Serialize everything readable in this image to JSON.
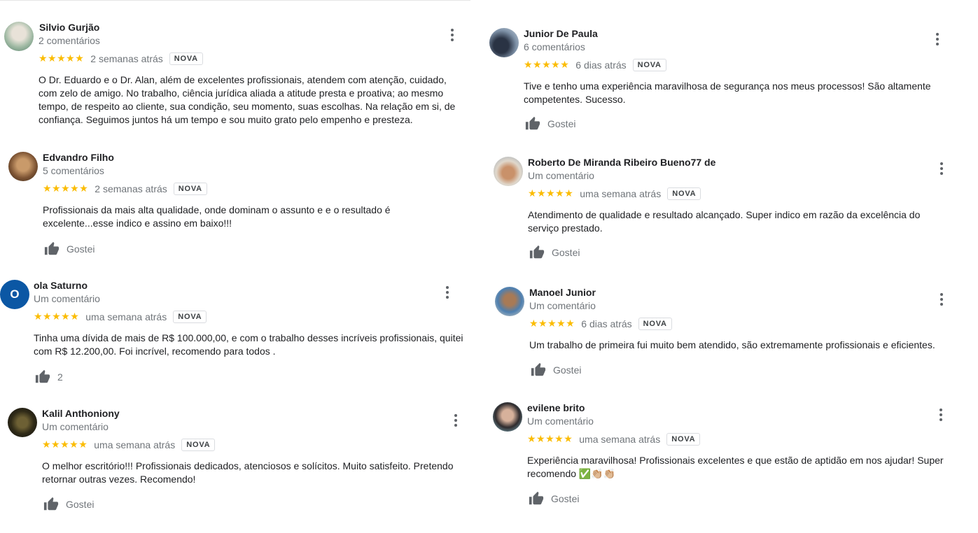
{
  "like_label": "Gostei",
  "badge_label": "NOVA",
  "stars_glyph": "★★★★★",
  "colors": {
    "star": "#fbbc04",
    "secondary_text": "#70757a",
    "avatar_letter_bg": "#0b57a4"
  },
  "reviews": [
    {
      "name": "Silvio Gurjão",
      "meta": "2 comentários",
      "date": "2 semanas atrás",
      "text": "O Dr. Eduardo e o Dr. Alan, além de excelentes profissionais, atendem com atenção, cuidado, com zelo de amigo. No trabalho, ciência jurídica aliada a atitude presta e proativa; ao mesmo tempo, de respeito ao cliente, sua condição, seu momento, suas escolhas. Na relação em si, de confiança. Seguimos juntos há um tempo e sou muito grato pelo empenho e presteza."
    },
    {
      "name": "Edvandro Filho",
      "meta": "5 comentários",
      "date": "2 semanas atrás",
      "text": "Profissionais da mais alta qualidade, onde dominam o assunto e e o resultado é excelente...esse indico e assino em baixo!!!"
    },
    {
      "name": "ola Saturno",
      "meta": "Um comentário",
      "date": "uma semana atrás",
      "avatar_letter": "O",
      "like_count": "2",
      "text": "Tinha uma dívida de mais de R$ 100.000,00, e com o trabalho desses incríveis profissionais, quitei com R$ 12.200,00. Foi incrível, recomendo para todos ."
    },
    {
      "name": "Kalil Anthoniony",
      "meta": "Um comentário",
      "date": "uma semana atrás",
      "text": "O melhor escritório!!! Profissionais dedicados, atenciosos e solícitos. Muito satisfeito. Pretendo retornar outras vezes. Recomendo!"
    },
    {
      "name": "Junior De Paula",
      "meta": "6 comentários",
      "date": "6 dias atrás",
      "text": "Tive e tenho uma experiência maravilhosa de segurança nos meus processos! São altamente competentes. Sucesso."
    },
    {
      "name": "Roberto De Miranda Ribeiro Bueno77 de",
      "meta": "Um comentário",
      "date": "uma semana atrás",
      "text": "Atendimento de qualidade e resultado alcançado. Super indico em razão da excelência do serviço prestado."
    },
    {
      "name": "Manoel Junior",
      "meta": "Um comentário",
      "date": "6 dias atrás",
      "text": "Um trabalho de primeira fui muito bem atendido, são extremamente profissionais e eficientes."
    },
    {
      "name": "evilene brito",
      "meta": "Um comentário",
      "date": "uma semana atrás",
      "text": "Experiência maravilhosa! Profissionais excelentes e que estão de aptidão em nos ajudar! Super recomendo ✅👏🏼👏🏼"
    }
  ]
}
